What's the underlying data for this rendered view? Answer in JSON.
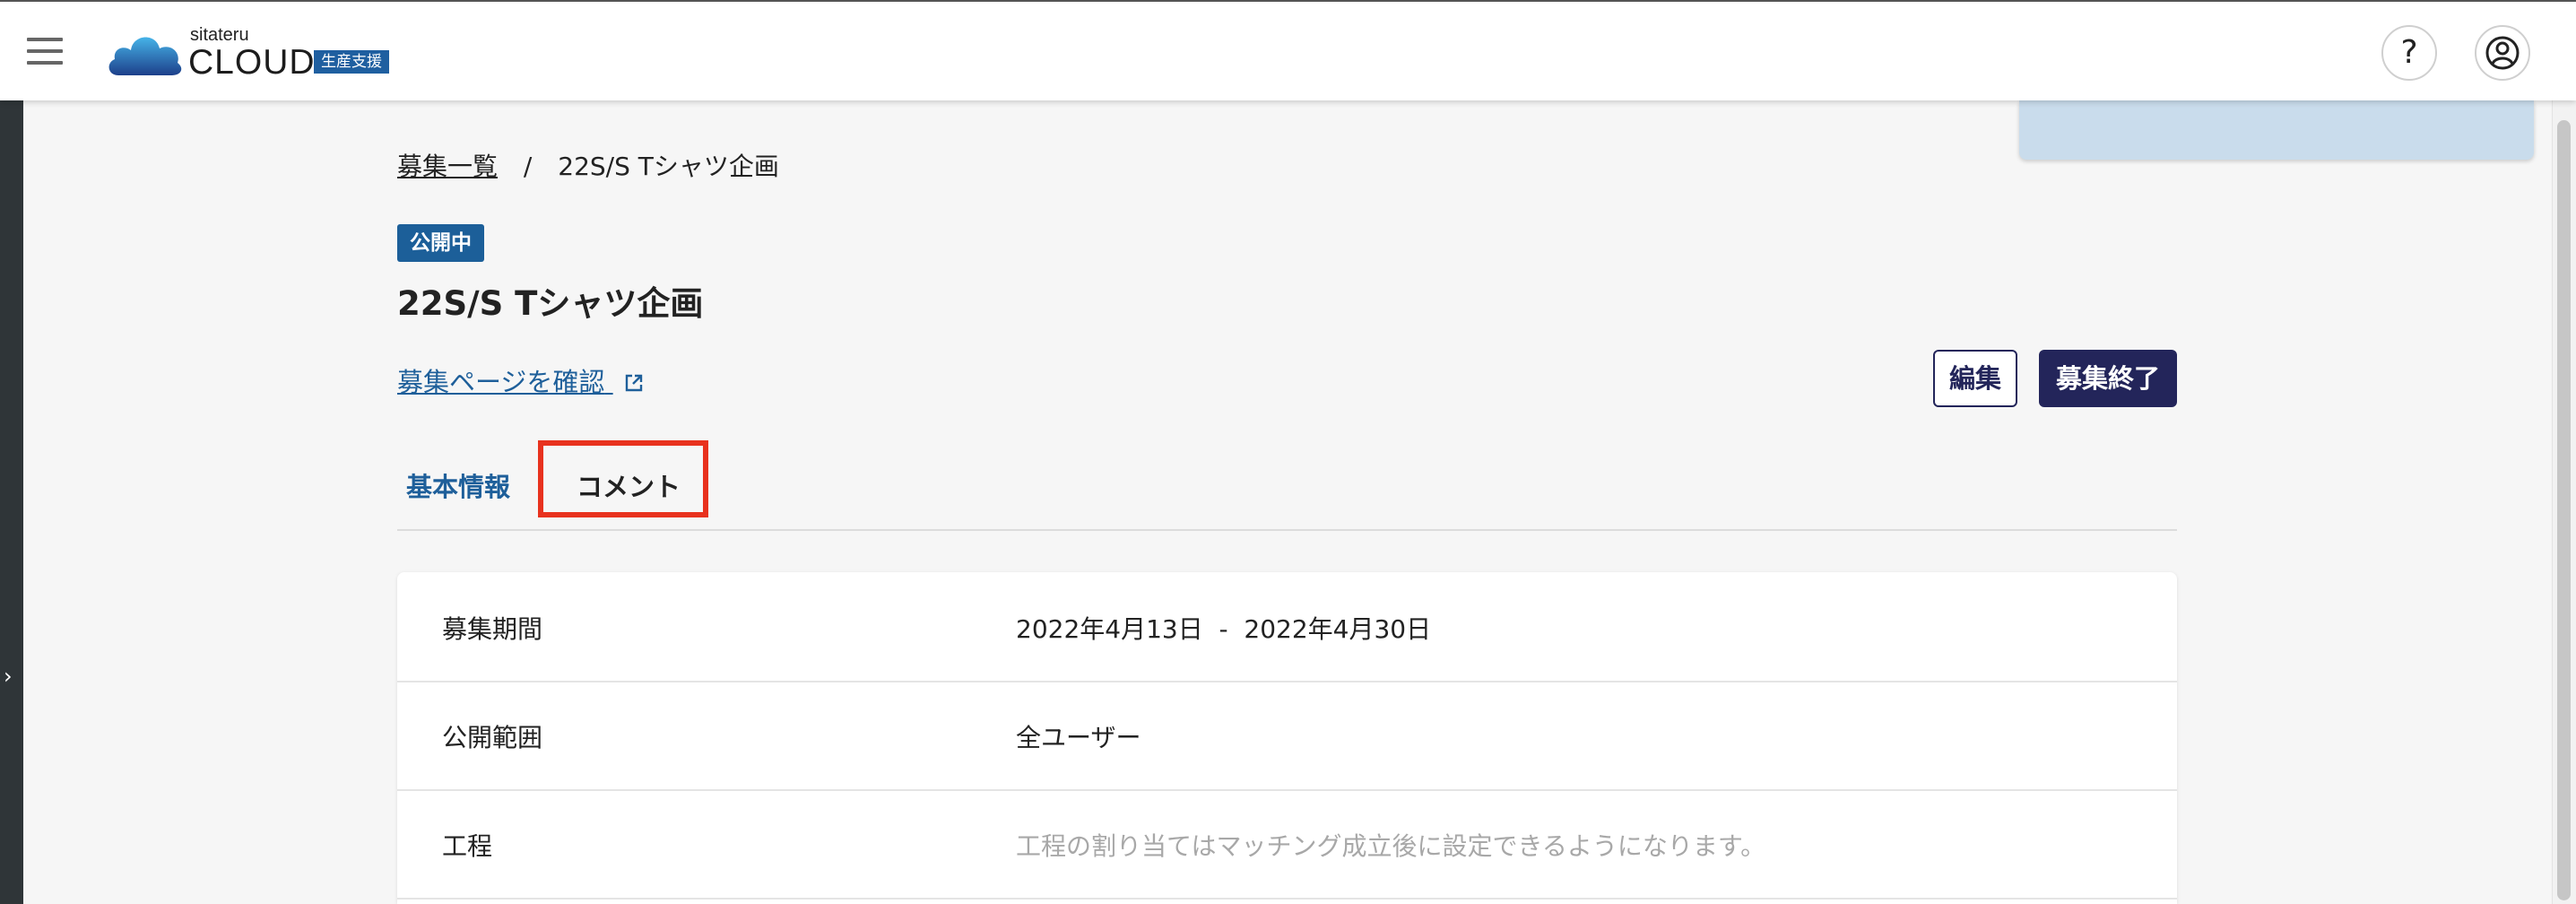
{
  "header": {
    "brand_small": "sitateru",
    "brand_main": "CLOUD",
    "brand_tag": "生産支援",
    "help_glyph": "?"
  },
  "breadcrumb": {
    "parent": "募集一覧",
    "separator": "/",
    "current": "22S/S Tシャツ企画"
  },
  "project": {
    "status": "公開中",
    "title": "22S/S Tシャツ企画",
    "recruit_page_link": "募集ページを確認",
    "edit_label": "編集",
    "end_label": "募集終了"
  },
  "tabs": [
    {
      "label": "基本情報",
      "active": true
    },
    {
      "label": "コメント",
      "active": false
    }
  ],
  "details": [
    {
      "label": "募集期間",
      "value": "2022年4月13日  -  2022年4月30日"
    },
    {
      "label": "公開範囲",
      "value": "全ユーザー"
    },
    {
      "label": "工程",
      "value": "工程の割り当てはマッチング成立後に設定できるようになります。"
    }
  ],
  "colors": {
    "brand_blue": "#1e5f9a",
    "button_navy": "#23255a",
    "highlight_red": "#e8321e"
  },
  "icons": {
    "menu": "hamburger-icon",
    "logo": "cloud-logo-icon",
    "help": "question-icon",
    "account": "user-circle-icon",
    "external": "external-link-icon",
    "rail": "chevron-right-icon"
  }
}
